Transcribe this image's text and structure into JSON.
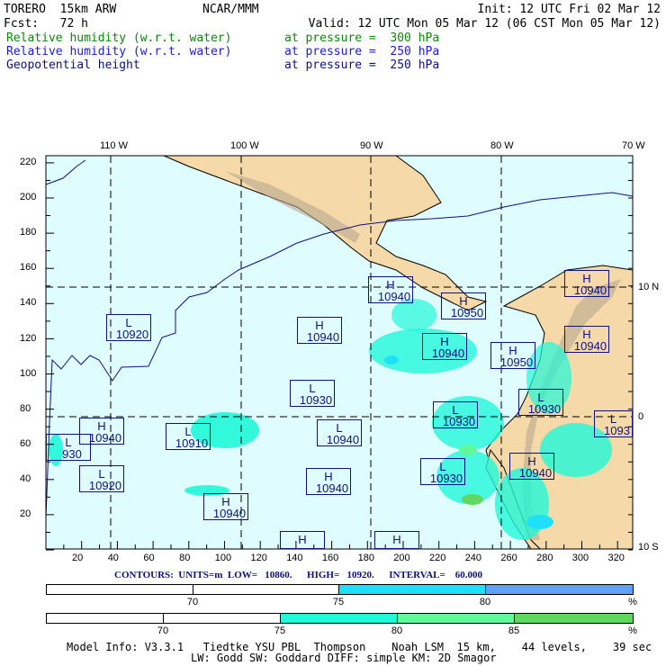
{
  "header": {
    "model": "TORERO  15km ARW",
    "org": "NCAR/MMM",
    "init": "Init: 12 UTC Fri 02 Mar 12",
    "fcst": "Fcst:   72 h",
    "valid": "Valid: 12 UTC Mon 05 Mar 12 (06 CST Mon 05 Mar 12)",
    "fields": [
      {
        "name": "Relative humidity (w.r.t. water)",
        "level": "at pressure =  300 hPa",
        "color": "#0a8a0a"
      },
      {
        "name": "Relative humidity (w.r.t. water)",
        "level": "at pressure =  250 hPa",
        "color": "#1a1ae0"
      },
      {
        "name": "Geopotential height",
        "level": "at pressure =  250 hPa",
        "color": "#101080"
      }
    ]
  },
  "axes": {
    "top": [
      "110 W",
      "100 W",
      "90 W",
      "80 W",
      "70 W"
    ],
    "right": [
      "10 N",
      "0",
      "10 S"
    ],
    "left": [
      "220",
      "200",
      "180",
      "160",
      "140",
      "120",
      "100",
      "80",
      "60",
      "40",
      "20"
    ],
    "bottom": [
      "20",
      "40",
      "60",
      "80",
      "100",
      "120",
      "140",
      "160",
      "180",
      "200",
      "220",
      "240",
      "260",
      "280",
      "300",
      "320"
    ]
  },
  "centers": [
    {
      "type": "L",
      "value": "10920"
    },
    {
      "type": "H",
      "value": "10940"
    },
    {
      "type": "H",
      "value": "10940"
    },
    {
      "type": "H",
      "value": "10950"
    },
    {
      "type": "H",
      "value": "10940"
    },
    {
      "type": "H",
      "value": "10950"
    },
    {
      "type": "H",
      "value": "10940"
    },
    {
      "type": "H",
      "value": "10940"
    },
    {
      "type": "L",
      "value": "10930"
    },
    {
      "type": "L",
      "value": "10930"
    },
    {
      "type": "L",
      "value": "10930"
    },
    {
      "type": "L",
      "value": "1093"
    },
    {
      "type": "H",
      "value": "10940"
    },
    {
      "type": "L",
      "value": "10910"
    },
    {
      "type": "L",
      "value": "10940"
    },
    {
      "type": "L",
      "value": "930"
    },
    {
      "type": "L",
      "value": "10920"
    },
    {
      "type": "H",
      "value": "10940"
    },
    {
      "type": "H",
      "value": "10940"
    },
    {
      "type": "L",
      "value": "10930"
    },
    {
      "type": "H",
      "value": "10940"
    },
    {
      "type": "H",
      "value": ""
    },
    {
      "type": "H",
      "value": ""
    }
  ],
  "contours": "CONTOURS:  UNITS=m  LOW=   10860.      HIGH=   10920.      INTERVAL=    60.000",
  "colorbar_250": {
    "labels": [
      "70",
      "75",
      "80",
      "%"
    ],
    "colors": [
      "#ffffff",
      "#ffffff",
      "#1ee0f8",
      "#60a0f8"
    ]
  },
  "colorbar_300": {
    "labels": [
      "70",
      "75",
      "80",
      "85",
      "%"
    ],
    "colors": [
      "#ffffff",
      "#ffffff",
      "#20f8d8",
      "#60f898",
      "#60d860"
    ]
  },
  "footer": {
    "line1": "Model Info: V3.3.1   Tiedtke YSU PBL  Thompson    Noah LSM  15 km,    44 levels,    39 sec",
    "line2": "LW: Godd SW: Goddard DIFF: simple KM: 2D Smagor"
  }
}
